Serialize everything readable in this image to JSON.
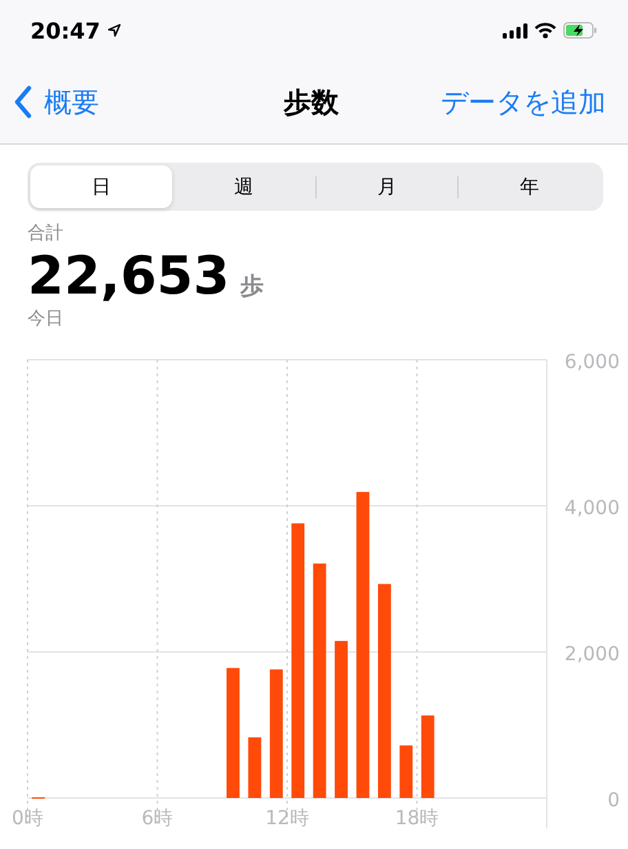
{
  "status_bar": {
    "time": "20:47"
  },
  "nav": {
    "back": "概要",
    "title": "歩数",
    "action": "データを追加"
  },
  "segments": [
    {
      "label": "日",
      "selected": true
    },
    {
      "label": "週",
      "selected": false
    },
    {
      "label": "月",
      "selected": false
    },
    {
      "label": "年",
      "selected": false
    }
  ],
  "summary": {
    "label": "合計",
    "value": "22,653",
    "unit": "歩",
    "period": "今日"
  },
  "chart_data": {
    "type": "bar",
    "x": [
      0.5,
      1.5,
      2.5,
      3.5,
      4.5,
      5.5,
      6.5,
      7.5,
      8.5,
      9.5,
      10.5,
      11.5,
      12.5,
      13.5,
      14.5,
      15.5,
      16.5,
      17.5,
      18.5,
      19.5,
      20.5,
      21.5,
      22.5,
      23.5
    ],
    "xlim": [
      0,
      24
    ],
    "grid": true,
    "series": [
      {
        "color": "#ff4a0a",
        "values": [
          10,
          0,
          0,
          0,
          0,
          0,
          0,
          0,
          0,
          1780,
          830,
          1760,
          3760,
          3210,
          2150,
          4190,
          2930,
          720,
          1130,
          0,
          0,
          0,
          0,
          0
        ]
      }
    ],
    "ylim": [
      0,
      6000
    ],
    "yticks": [
      {
        "value": 0,
        "label": "0"
      },
      {
        "value": 2000,
        "label": "2,000"
      },
      {
        "value": 4000,
        "label": "4,000"
      },
      {
        "value": 6000,
        "label": "6,000"
      }
    ],
    "xticks": [
      {
        "value": 0,
        "label": "0時"
      },
      {
        "value": 6,
        "label": "6時"
      },
      {
        "value": 12,
        "label": "12時"
      },
      {
        "value": 18,
        "label": "18時"
      }
    ]
  }
}
